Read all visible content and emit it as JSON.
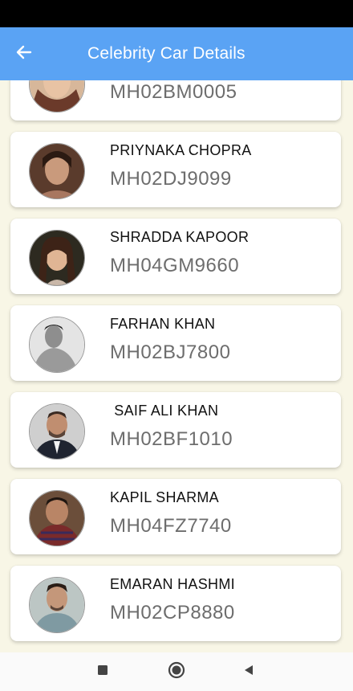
{
  "app_bar": {
    "title": "Celebrity Car Details",
    "back_icon": "arrow-left-icon"
  },
  "colors": {
    "app_bar": "#5aa3f4",
    "page_bg": "#f8f6e6",
    "plate_text": "#6d6d6d"
  },
  "cars": [
    {
      "name": "",
      "plate": "MH02BM0005"
    },
    {
      "name": "PRIYNAKA CHOPRA",
      "plate": "MH02DJ9099"
    },
    {
      "name": "SHRADDA KAPOOR",
      "plate": "MH04GM9660"
    },
    {
      "name": "FARHAN KHAN",
      "plate": "MH02BJ7800"
    },
    {
      "name": " SAIF ALI KHAN",
      "plate": "MH02BF1010"
    },
    {
      "name": "KAPIL SHARMA",
      "plate": "MH04FZ7740"
    },
    {
      "name": "EMARAN HASHMI",
      "plate": "MH02CP8880"
    }
  ],
  "nav": {
    "recents_icon": "square-icon",
    "home_icon": "circle-icon",
    "back_icon": "triangle-back-icon"
  }
}
